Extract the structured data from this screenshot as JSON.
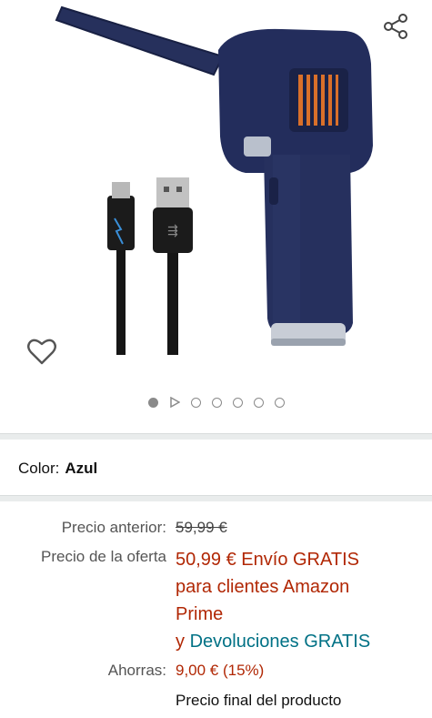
{
  "gallery": {
    "dots_count": 6,
    "active_index": 0
  },
  "color": {
    "label": "Color:",
    "value": "Azul"
  },
  "price": {
    "previous_label": "Precio anterior:",
    "previous_value": "59,99 €",
    "deal_label": "Precio de la oferta",
    "deal_price": "50,99 €",
    "shipping_line1": "Envío GRATIS",
    "shipping_line2": "para clientes Amazon",
    "shipping_line3": "Prime",
    "returns_prefix": "y",
    "returns_link": "Devoluciones GRATIS",
    "save_label": "Ahorras:",
    "save_value": "9,00 € (15%)",
    "final_text": "Precio final del producto"
  },
  "colors": {
    "deal": "#b12704",
    "link": "#007185",
    "product_body": "#1f2a55"
  }
}
